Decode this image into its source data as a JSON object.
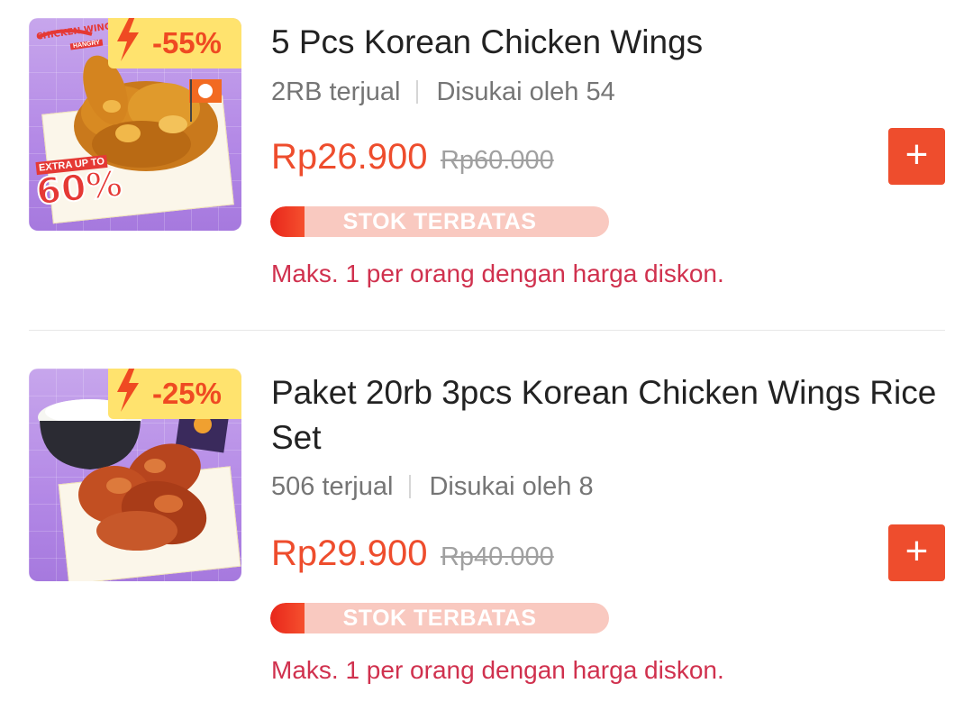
{
  "products": [
    {
      "discount": "-55%",
      "title": "5 Pcs Korean Chicken Wings",
      "sold": "2RB terjual",
      "liked": "Disukai oleh 54",
      "price": "Rp26.900",
      "original_price": "Rp60.000",
      "stock_label": "STOK TERBATAS",
      "stock_fill": 0.1,
      "limit_note": "Maks. 1 per orang dengan harga diskon.",
      "add_label": "+",
      "image_text": {
        "brand": "CHICKEN WING",
        "sub": "HANGRY",
        "promo_small": "EXTRA UP TO",
        "promo_big": "60%"
      }
    },
    {
      "discount": "-25%",
      "title": "Paket 20rb 3pcs Korean Chicken Wings Rice Set",
      "sold": "506 terjual",
      "liked": "Disukai oleh 8",
      "price": "Rp29.900",
      "original_price": "Rp40.000",
      "stock_label": "STOK TERBATAS",
      "stock_fill": 0.1,
      "limit_note": "Maks. 1 per orang dengan harga diskon.",
      "add_label": "+"
    }
  ],
  "colors": {
    "accent": "#ee4d2d",
    "badge_bg": "#ffe36e",
    "limit_text": "#d0314e",
    "image_bg": "#b388e6"
  },
  "icons": [
    "lightning-bolt-icon",
    "plus-icon"
  ]
}
